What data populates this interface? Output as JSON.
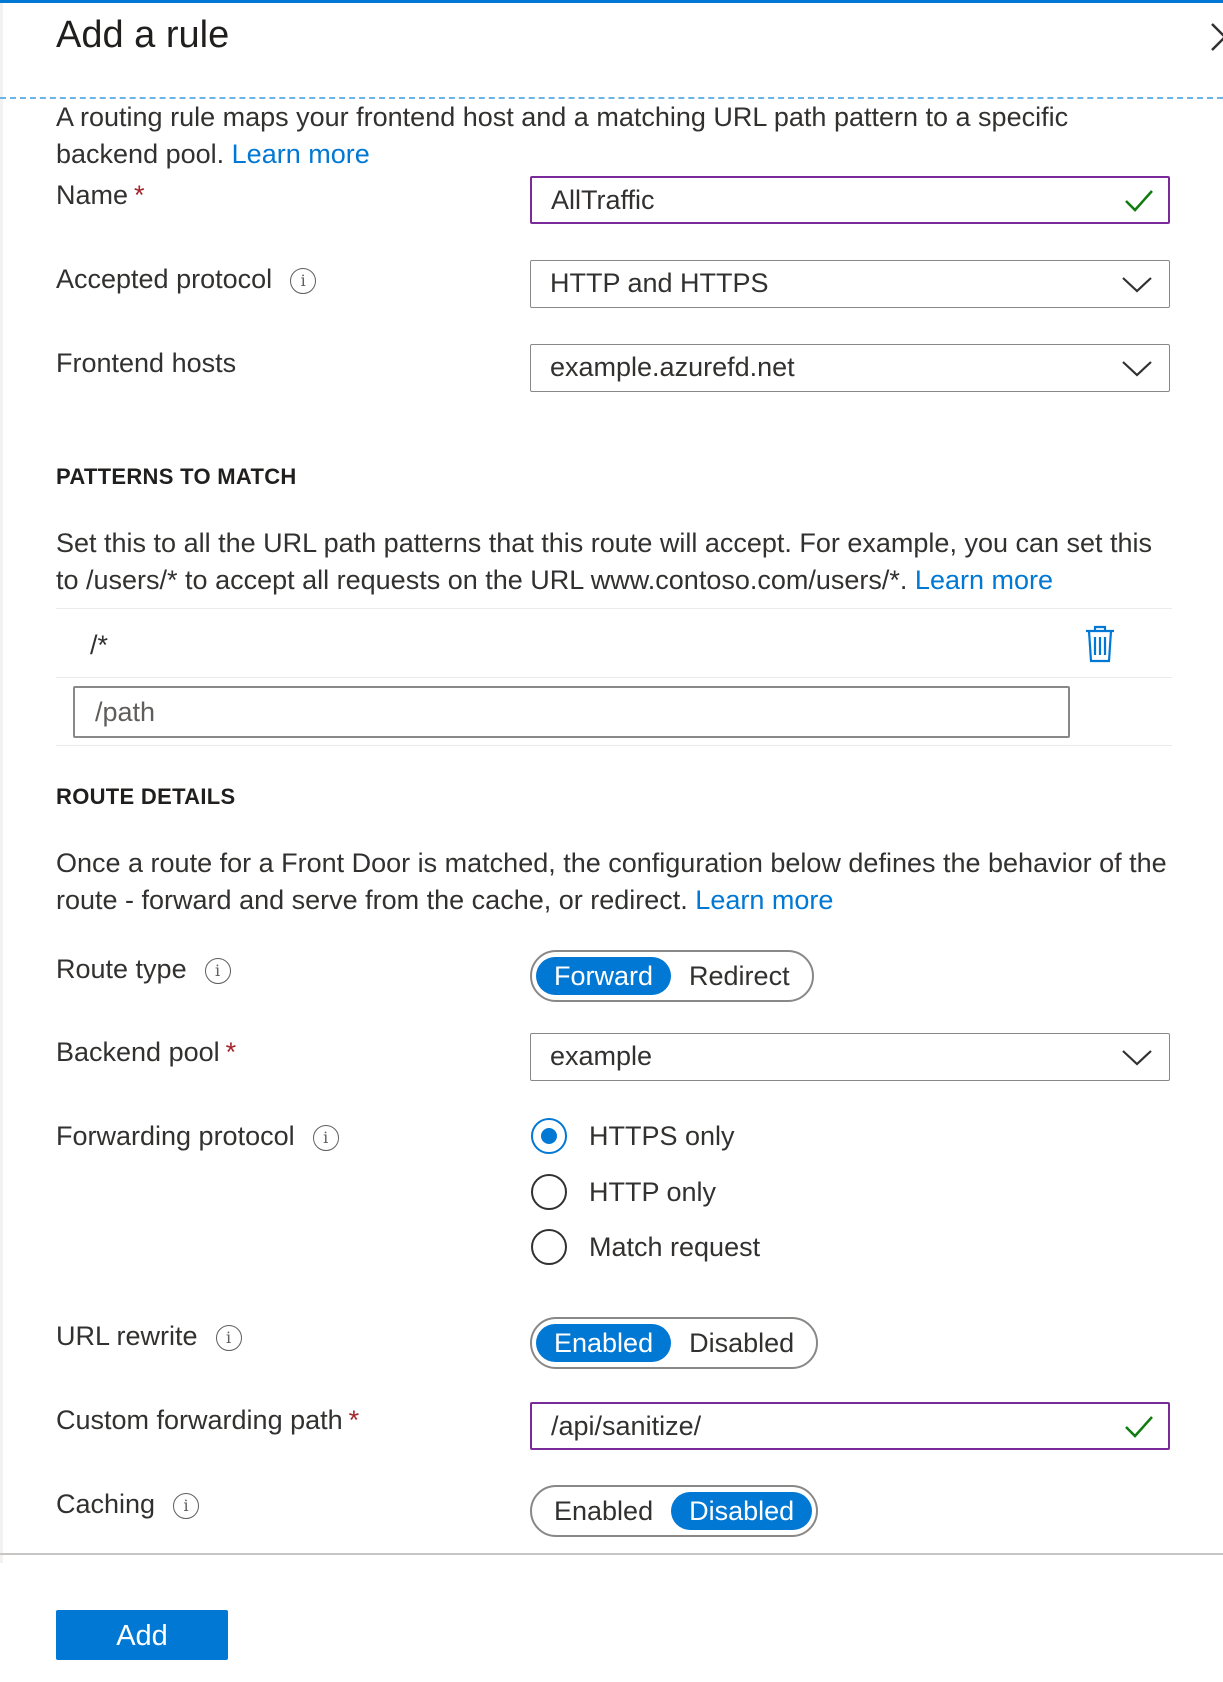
{
  "panel": {
    "title": "Add a rule",
    "close_label": "×",
    "intro": "A routing rule maps your frontend host and a matching URL path pattern to a specific backend pool.",
    "intro_link": "Learn more"
  },
  "form": {
    "name": {
      "label": "Name",
      "required": "*",
      "value": "AllTraffic"
    },
    "accepted_protocol": {
      "label": "Accepted protocol",
      "value": "HTTP and HTTPS"
    },
    "frontend_hosts": {
      "label": "Frontend hosts",
      "value": "example.azurefd.net"
    }
  },
  "patterns": {
    "heading": "PATTERNS TO MATCH",
    "description": "Set this to all the URL path patterns that this route will accept. For example, you can set this to /users/* to accept all requests on the URL www.contoso.com/users/*.",
    "link": "Learn more",
    "items": [
      "/*"
    ],
    "placeholder": "/path"
  },
  "route": {
    "heading": "ROUTE DETAILS",
    "description": "Once a route for a Front Door is matched, the configuration below defines the behavior of the route - forward and serve from the cache, or redirect.",
    "link": "Learn more",
    "route_type": {
      "label": "Route type",
      "options": [
        "Forward",
        "Redirect"
      ],
      "selected": "Forward"
    },
    "backend_pool": {
      "label": "Backend pool",
      "required": "*",
      "value": "example"
    },
    "forwarding_protocol": {
      "label": "Forwarding protocol",
      "options": [
        "HTTPS only",
        "HTTP only",
        "Match request"
      ],
      "selected": "HTTPS only"
    },
    "url_rewrite": {
      "label": "URL rewrite",
      "options": [
        "Enabled",
        "Disabled"
      ],
      "selected": "Enabled"
    },
    "custom_forwarding_path": {
      "label": "Custom forwarding path",
      "required": "*",
      "value": "/api/sanitize/"
    },
    "caching": {
      "label": "Caching",
      "options": [
        "Enabled",
        "Disabled"
      ],
      "selected": "Disabled"
    }
  },
  "footer": {
    "add_label": "Add"
  },
  "colors": {
    "accent": "#0078d4",
    "valid_border": "#7a2b9a",
    "check": "#107c10",
    "required": "#a4262c"
  },
  "icons": {
    "info": "info-icon",
    "chevron": "chevron-down-icon",
    "check": "checkmark-icon",
    "delete": "trash-icon",
    "close": "close-icon"
  }
}
